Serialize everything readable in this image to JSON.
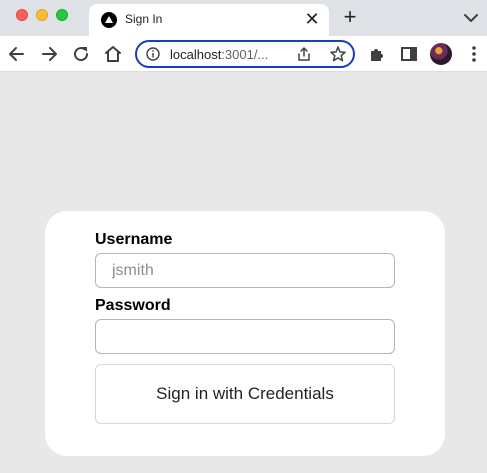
{
  "browser": {
    "tab_title": "Sign In",
    "tab_close": "✕",
    "new_tab": "+",
    "url_host": "localhost",
    "url_rest": ":3001/..."
  },
  "icons": [
    "back-icon",
    "forward-icon",
    "reload-icon",
    "home-icon",
    "info-icon",
    "share-icon",
    "star-icon",
    "extensions-icon",
    "sidebar-icon",
    "menu-icon"
  ],
  "form": {
    "username_label": "Username",
    "username_placeholder": "jsmith",
    "username_value": "",
    "password_label": "Password",
    "password_value": "",
    "submit_label": "Sign in with Credentials"
  },
  "colors": {
    "page_bg": "#e8e8e8",
    "omnibox_focus": "#1a3cbf"
  }
}
